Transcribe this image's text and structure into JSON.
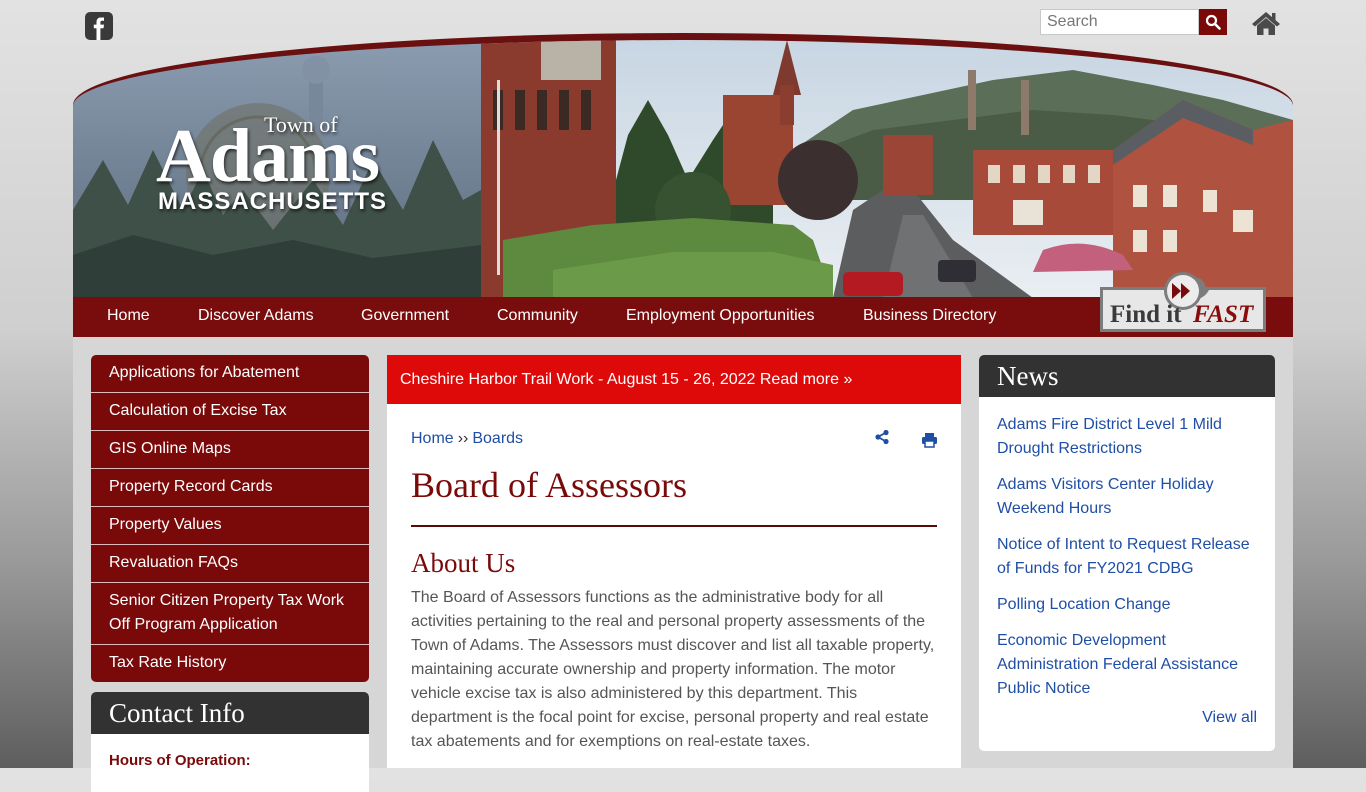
{
  "header": {
    "search": {
      "placeholder": "Search"
    }
  },
  "logo": {
    "town_of": "Town of",
    "name": "Adams",
    "state": "MASSACHUSETTS"
  },
  "nav": {
    "items": [
      "Home",
      "Discover Adams",
      "Government",
      "Community",
      "Employment Opportunities",
      "Business Directory"
    ],
    "find_it_fast": {
      "find": "Find it",
      "fast": "FAST"
    }
  },
  "sidebar": {
    "items": [
      "Applications for Abatement",
      "Calculation of Excise Tax",
      "GIS Online Maps",
      "Property Record Cards",
      "Property Values",
      "Revaluation FAQs",
      "Senior Citizen Property Tax Work Off Program Application",
      "Tax Rate History"
    ],
    "contact": {
      "title": "Contact Info",
      "hours_label": "Hours of Operation:"
    }
  },
  "alert": {
    "text": "Cheshire Harbor Trail Work - August 15 - 26, 2022 Read more »"
  },
  "main": {
    "breadcrumb": {
      "home": "Home",
      "separator": "››",
      "current": "Boards"
    },
    "title": "Board of Assessors",
    "about": {
      "heading": "About Us",
      "body": "The Board of Assessors functions as the administrative body for all activities pertaining to the real and personal property assessments of the Town of Adams. The Assessors must discover and list all taxable property, maintaining accurate ownership and property information. The motor vehicle excise tax is also administered by this department. This department is the focal point for excise, personal property and real estate tax abatements and for exemptions on real-estate taxes."
    }
  },
  "news": {
    "title": "News",
    "items": [
      "Adams Fire District Level 1 Mild Drought Restrictions",
      "Adams Visitors Center Holiday Weekend Hours",
      "Notice of Intent to Request Release of Funds for FY2021 CDBG",
      "Polling Location Change",
      "Economic Development Administration Federal Assistance Public Notice"
    ],
    "view_all": "View all"
  },
  "colors": {
    "brand": "#7a0a0a",
    "alert": "#de0a0a",
    "link": "#1f4ea6",
    "panel_header": "#323232"
  }
}
